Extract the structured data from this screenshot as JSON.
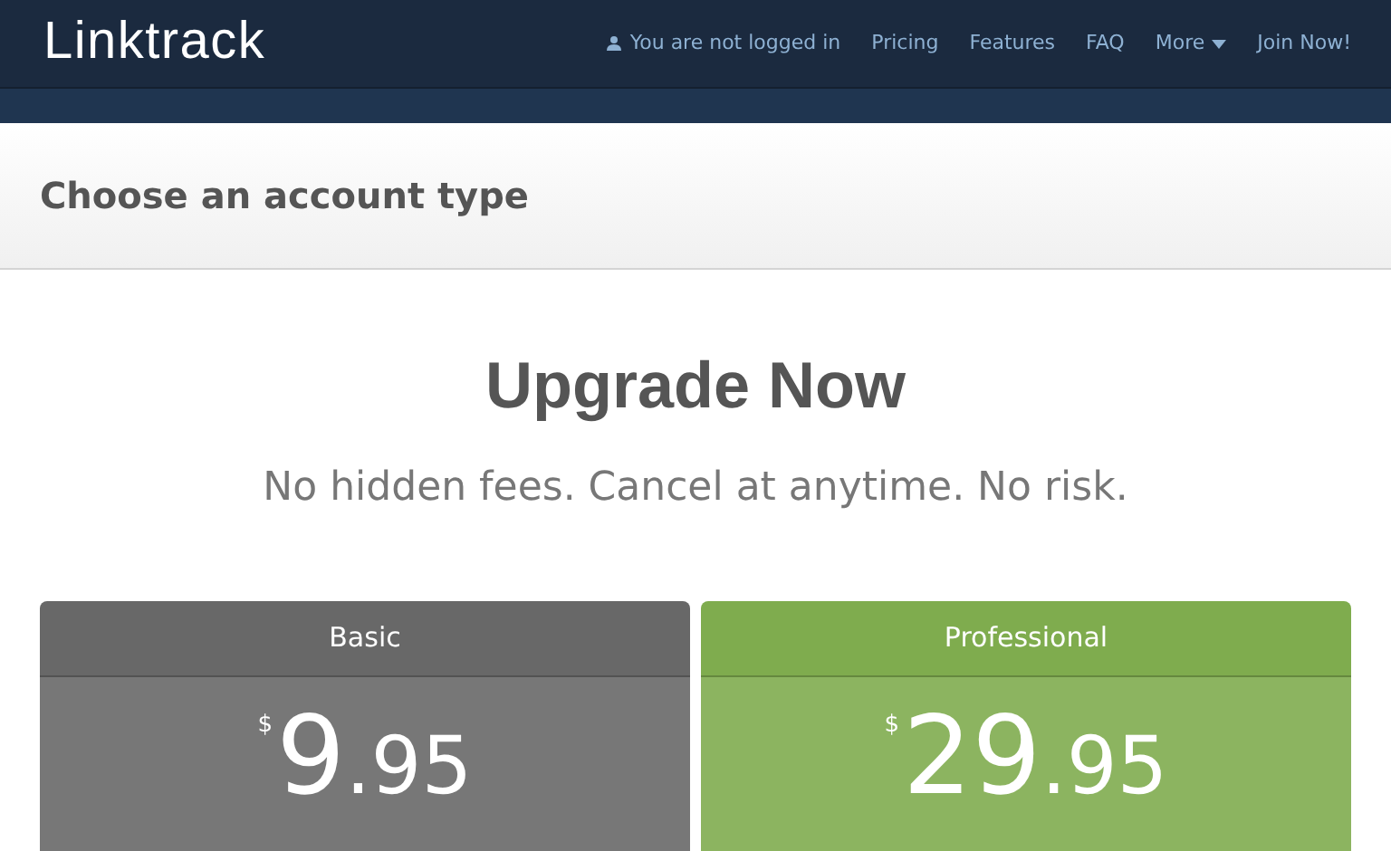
{
  "navbar": {
    "brand": "Linktrack",
    "login_status": "You are not logged in",
    "links": [
      {
        "label": "Pricing",
        "dropdown": false
      },
      {
        "label": "Features",
        "dropdown": false
      },
      {
        "label": "FAQ",
        "dropdown": false
      },
      {
        "label": "More",
        "dropdown": true
      },
      {
        "label": "Join Now!",
        "dropdown": false
      }
    ]
  },
  "page_header": {
    "title": "Choose an account type"
  },
  "hero": {
    "title": "Upgrade Now",
    "subtitle": "No hidden fees. Cancel at anytime. No risk."
  },
  "plans": [
    {
      "name": "Basic",
      "color": "#686868",
      "currency": "$",
      "whole": "9",
      "cents": ".95"
    },
    {
      "name": "Professional",
      "color": "#7fac4e",
      "currency": "$",
      "whole": "29",
      "cents": ".95"
    }
  ]
}
